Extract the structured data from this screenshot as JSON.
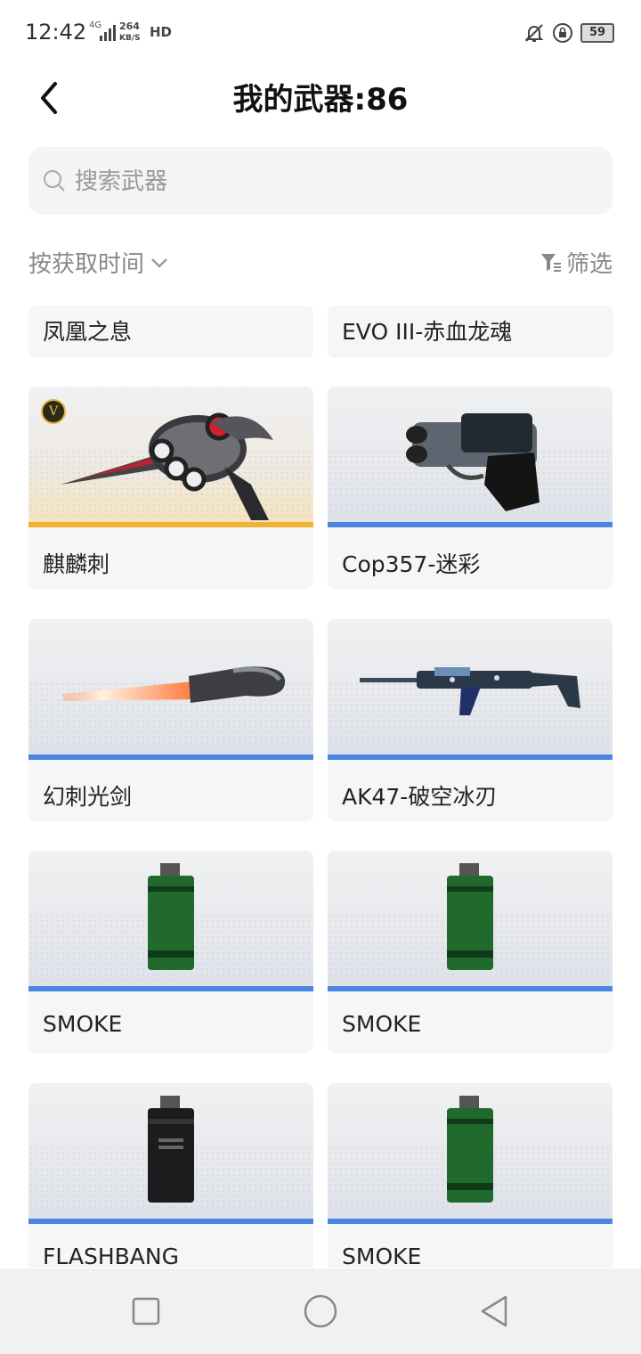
{
  "status_bar": {
    "time": "12:42",
    "network": "4G",
    "speed_value": "264",
    "speed_unit": "KB/S",
    "hd": "HD",
    "battery": "59"
  },
  "header": {
    "title": "我的武器:86",
    "back_icon": "chevron-left-icon"
  },
  "search": {
    "placeholder": "搜索武器",
    "value": ""
  },
  "toolbar": {
    "sort_label": "按获取时间",
    "filter_label": "筛选"
  },
  "weapons": [
    {
      "name": "凤凰之息",
      "rarity": "partial"
    },
    {
      "name": "EVO III-赤血龙魂",
      "rarity": "partial"
    },
    {
      "name": "麒麟刺",
      "rarity": "gold",
      "badge": "V"
    },
    {
      "name": "Cop357-迷彩",
      "rarity": "blue"
    },
    {
      "name": "幻刺光剑",
      "rarity": "blue"
    },
    {
      "name": "AK47-破空冰刃",
      "rarity": "blue"
    },
    {
      "name": "SMOKE",
      "rarity": "blue"
    },
    {
      "name": "SMOKE",
      "rarity": "blue"
    },
    {
      "name": "FLASHBANG",
      "rarity": "blue"
    },
    {
      "name": "SMOKE",
      "rarity": "blue"
    }
  ],
  "colors": {
    "blue_stripe": "#4a86e0",
    "gold_stripe": "#f0b434"
  },
  "nav_bar": {
    "recent_icon": "square-icon",
    "home_icon": "circle-icon",
    "back_icon": "triangle-back-icon"
  }
}
